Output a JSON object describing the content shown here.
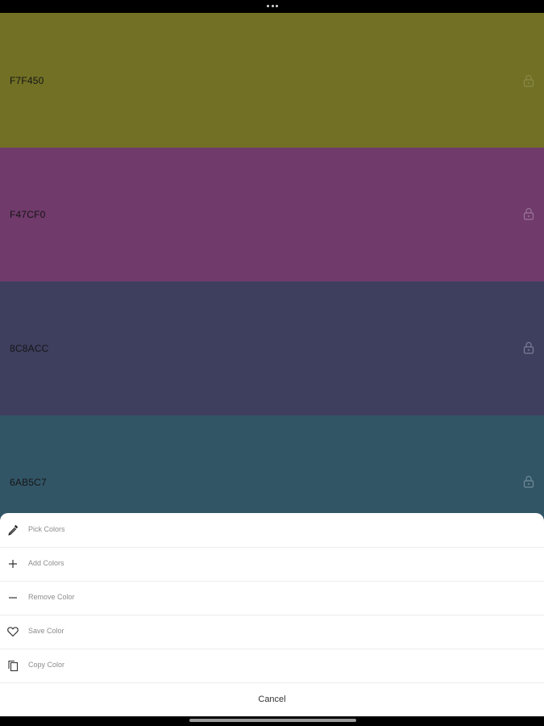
{
  "swatches": [
    {
      "hex": "F7F450",
      "background": "#717025"
    },
    {
      "hex": "F47CF0",
      "background": "#703a6b"
    },
    {
      "hex": "8C8ACC",
      "background": "#3e3f5f"
    },
    {
      "hex": "6AB5C7",
      "background": "#325566"
    }
  ],
  "menu": {
    "items": [
      {
        "label": "Pick Colors",
        "icon": "eyedropper-icon"
      },
      {
        "label": "Add Colors",
        "icon": "plus-icon"
      },
      {
        "label": "Remove Color",
        "icon": "minus-icon"
      },
      {
        "label": "Save Color",
        "icon": "heart-icon"
      },
      {
        "label": "Copy Color",
        "icon": "copy-icon"
      }
    ],
    "cancel_label": "Cancel"
  },
  "icons": {
    "swatch_lock": "lock-icon"
  }
}
